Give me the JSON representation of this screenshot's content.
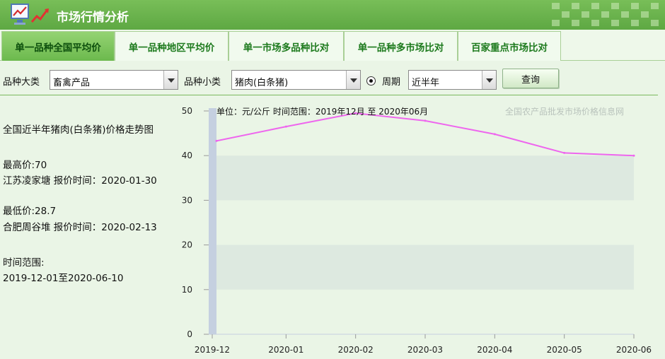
{
  "app": {
    "title": "市场行情分析",
    "logo_icon": "chart-monitor-icon"
  },
  "tabs": [
    {
      "label": "单一品种全国平均价",
      "active": true
    },
    {
      "label": "单一品种地区平均价",
      "active": false
    },
    {
      "label": "单一市场多品种比对",
      "active": false
    },
    {
      "label": "单一品种多市场比对",
      "active": false
    },
    {
      "label": "百家重点市场比对",
      "active": false
    }
  ],
  "filters": {
    "category_label": "品种大类",
    "category_value": "畜禽产品",
    "subcategory_label": "品种小类",
    "subcategory_value": "猪肉(白条猪)",
    "period_label": "周期",
    "period_value": "近半年",
    "query_button": "查询"
  },
  "info": {
    "heading": "全国近半年猪肉(白条猪)价格走势图",
    "max_price": "最高价:70",
    "max_detail": "江苏凌家塘 报价时间：2020-01-30",
    "min_price": "最低价:28.7",
    "min_detail": "合肥周谷堆 报价时间：2020-02-13",
    "range_label": "时间范围:",
    "range_value": "2019-12-01至2020-06-10"
  },
  "colors": {
    "header": "#6cb44e",
    "line": "#ee66ee",
    "band": "#dde9e0",
    "axis_bar": "#c5d0e0"
  },
  "chart_data": {
    "type": "line",
    "title": "单位：元/公斤 时间范围：2019年12月 至 2020年06月",
    "watermark": "全国农产品批发市场价格信息网",
    "categories": [
      "2019-12",
      "2020-01",
      "2020-02",
      "2020-03",
      "2020-04",
      "2020-05",
      "2020-06"
    ],
    "yticks": [
      0,
      10,
      20,
      30,
      40,
      50
    ],
    "ylim": [
      0,
      50
    ],
    "series": [
      {
        "values": [
          43.3,
          46.5,
          49.5,
          47.8,
          44.8,
          40.6,
          40.0
        ]
      }
    ]
  }
}
